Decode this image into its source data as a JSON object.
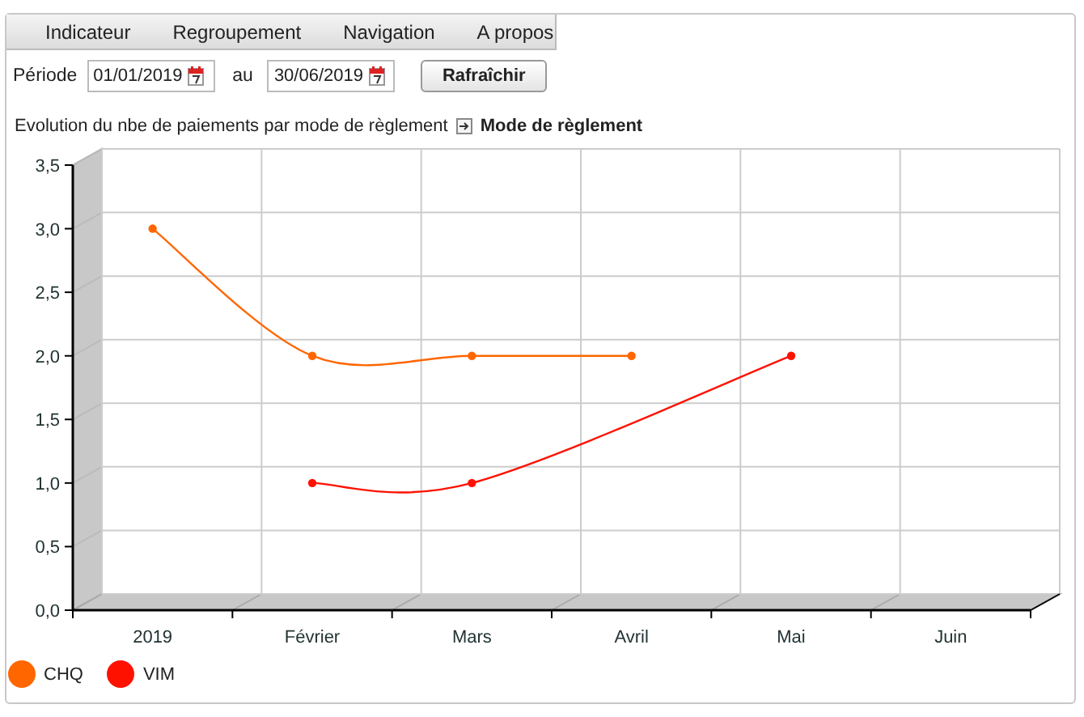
{
  "menu": [
    {
      "label": "Indicateur"
    },
    {
      "label": "Regroupement"
    },
    {
      "label": "Navigation"
    },
    {
      "label": "A propos"
    }
  ],
  "filters": {
    "period_label": "Période",
    "start_date": "01/01/2019",
    "between_label": "au",
    "end_date": "30/06/2019",
    "refresh_button": "Rafraîchir"
  },
  "chart": {
    "title": "Evolution du nbe de paiements par mode de règlement",
    "drilldown_label": "Mode de règlement",
    "chart_data": {
      "type": "line",
      "categories": [
        "2019",
        "Février",
        "Mars",
        "Avril",
        "Mai",
        "Juin"
      ],
      "series": [
        {
          "name": "CHQ",
          "color": "#ff6600",
          "marker": "circle",
          "values": [
            3,
            2,
            2,
            2,
            null,
            null
          ]
        },
        {
          "name": "VIM",
          "color": "#ff1100",
          "marker": "circle",
          "values": [
            null,
            1,
            1,
            null,
            2,
            null
          ]
        }
      ],
      "ylim": [
        0,
        3.5
      ],
      "yticks": [
        {
          "value": 0,
          "label": "0,0"
        },
        {
          "value": 0.5,
          "label": "0,5"
        },
        {
          "value": 1,
          "label": "1,0"
        },
        {
          "value": 1.5,
          "label": "1,5"
        },
        {
          "value": 2,
          "label": "2,0"
        },
        {
          "value": 2.5,
          "label": "2,5"
        },
        {
          "value": 3,
          "label": "3,0"
        },
        {
          "value": 3.5,
          "label": "3,5"
        }
      ]
    }
  }
}
